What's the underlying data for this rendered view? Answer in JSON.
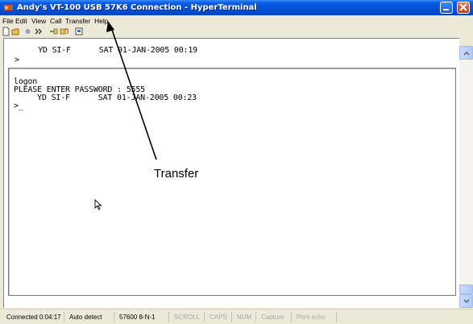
{
  "window": {
    "title": "Andy's VT-100 USB 57K6 Connection - HyperTerminal"
  },
  "menu": {
    "items": [
      "File",
      "Edit",
      "View",
      "Call",
      "Transfer",
      "Help"
    ]
  },
  "toolbar": {
    "icons": [
      "new-icon",
      "open-icon",
      "connect-icon",
      "disconnect-icon",
      "send-icon",
      "receive-icon",
      "properties-icon"
    ]
  },
  "terminal": {
    "top_lines": [
      "     YD SI-F      SAT 01-JAN-2005 00:19",
      ">"
    ],
    "main_lines": [
      "logon",
      "PLEASE ENTER PASSWORD : 5555",
      "     YD SI-F      SAT 01-JAN-2005 00:23",
      ">_"
    ]
  },
  "status": {
    "connected": "Connected 0:04:17",
    "detect": "Auto detect",
    "params": "57600 8-N-1",
    "scroll": "SCROLL",
    "caps": "CAPS",
    "num": "NUM",
    "capture": "Capture",
    "print_echo": "Print echo"
  },
  "annotation": {
    "label": "Transfer"
  },
  "colors": {
    "titlebar": "#0450d6",
    "window_bg": "#ece9d8",
    "terminal_bg": "#ffffff"
  }
}
